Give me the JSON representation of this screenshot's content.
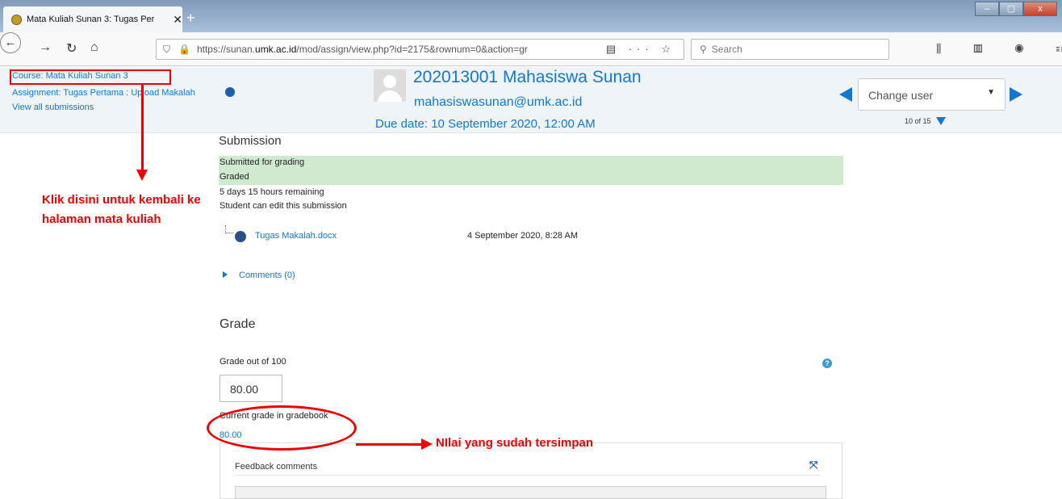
{
  "browser": {
    "tab_title": "Mata Kuliah Sunan 3: Tugas Per",
    "tab_close": "✕",
    "new_tab": "+",
    "url_prefix": "https://sunan.",
    "url_domain": "umk.ac.id",
    "url_rest": "/mod/assign/view.php?id=2175&rownum=0&action=gr",
    "search_placeholder": "Search",
    "window_controls": [
      "–",
      "▢",
      "x"
    ]
  },
  "header": {
    "course_link": "Course: Mata Kuliah Sunan 3",
    "assignment_link": "Assignment: Tugas Pertama : Upload Makalah",
    "view_all": "View all submissions",
    "user_name": "202013001 Mahasiswa Sunan",
    "user_email": "mahasiswasunan@umk.ac.id",
    "due_date": "Due date: 10 September 2020, 12:00 AM",
    "change_user": "Change user",
    "user_count": "10 of 15"
  },
  "submission": {
    "heading": "Submission",
    "status_submitted": "Submitted for grading",
    "status_graded": "Graded",
    "time_remaining": "5 days 15 hours remaining",
    "can_edit": "Student can edit this submission",
    "file_name": "Tugas Makalah.docx",
    "file_date": "4 September 2020, 8:28 AM",
    "comments": "Comments (0)"
  },
  "grade": {
    "heading": "Grade",
    "out_of_label": "Grade out of 100",
    "input_value": "80.00",
    "current_label": "Current grade in gradebook",
    "current_value": "80.00",
    "help": "?"
  },
  "feedback": {
    "label": "Feedback comments"
  },
  "annotations": {
    "course_note": "Klik disini untuk kembali ke halaman mata kuliah",
    "grade_note": "NIlai yang sudah tersimpan",
    "color": "#e00000"
  },
  "colors": {
    "link": "#1177d1",
    "graded_bg": "#cfeacf",
    "header_bg": "#eef4f8"
  }
}
